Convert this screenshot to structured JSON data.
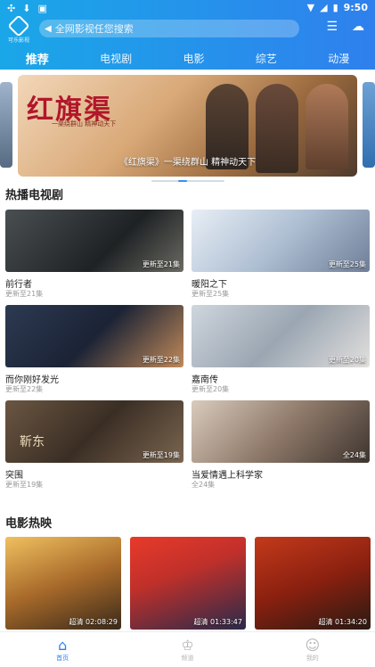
{
  "status": {
    "time": "9:50"
  },
  "logo": {
    "text": "可乐影视"
  },
  "search": {
    "placeholder": "全网影视任您搜索"
  },
  "tabs": [
    {
      "label": "推荐",
      "active": true
    },
    {
      "label": "电视剧"
    },
    {
      "label": "电影"
    },
    {
      "label": "综艺"
    },
    {
      "label": "动漫"
    }
  ],
  "banner": {
    "art_title": "红旗渠",
    "art_subtitle": "一渠绕群山 精神动天下",
    "caption": "《红旗渠》一渠绕群山 精神动天下"
  },
  "sections": {
    "tv": "热播电视剧",
    "movies": "电影热映"
  },
  "tv_shows": [
    {
      "name": "前行者",
      "badge": "更新至21集",
      "sub": "更新至21集"
    },
    {
      "name": "暖阳之下",
      "badge": "更新至25集",
      "sub": "更新至25集"
    },
    {
      "name": "而你刚好发光",
      "badge": "更新至22集",
      "sub": "更新至22集"
    },
    {
      "name": "嘉南传",
      "badge": "更新至20集",
      "sub": "更新至20集"
    },
    {
      "name": "突围",
      "badge": "更新至19集",
      "sub": "更新至19集",
      "overlay": "靳东"
    },
    {
      "name": "当爱情遇上科学家",
      "badge": "全24集",
      "sub": "全24集"
    }
  ],
  "movies": [
    {
      "badge": "超清 02:08:29"
    },
    {
      "badge": "超清 01:33:47"
    },
    {
      "badge": "超清 01:34:20"
    }
  ],
  "bottom_nav": [
    {
      "label": "首页",
      "active": true
    },
    {
      "label": "频道"
    },
    {
      "label": "我的"
    }
  ]
}
